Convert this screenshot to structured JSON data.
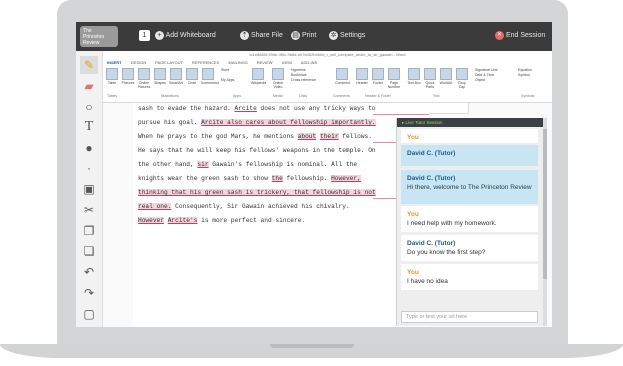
{
  "header": {
    "logo_line1": "The",
    "logo_line2": "Princeton",
    "logo_line3": "Review",
    "page_number": "1",
    "add_whiteboard": "Add Whiteboard",
    "share_file": "Share File",
    "print": "Print",
    "settings": "Settings",
    "end_session": "End Session"
  },
  "word": {
    "title": "tc1e6880f-93de-4f0c-9b6d-b07a452b4b0d_r_will_compare_arcite_to_sir_gawain - Word",
    "tabs": [
      "INSERT",
      "DESIGN",
      "PAGE LAYOUT",
      "REFERENCES",
      "MAILINGS",
      "REVIEW",
      "VIEW",
      "ADD-INS"
    ],
    "ribbon_buttons": [
      "Table",
      "Pictures",
      "Online Pictures",
      "Shapes",
      "SmartArt",
      "Chart",
      "Screenshot",
      "Store",
      "My Apps",
      "Wikipedia",
      "Online Video",
      "Hyperlink",
      "Bookmark",
      "Cross-reference",
      "Comment",
      "Header",
      "Footer",
      "Page Number",
      "Text Box",
      "Quick Parts",
      "WordArt",
      "Drop Cap",
      "Signature Line",
      "Date & Time",
      "Object",
      "Equation",
      "Symbol"
    ],
    "ribbon_groups": [
      "Tables",
      "Illustrations",
      "Apps",
      "Media",
      "Links",
      "Comments",
      "Header & Footer",
      "Text",
      "Symbols"
    ],
    "user_name": "Arna",
    "comment_name": "Anna",
    "comment_text": "bad use of",
    "lines": [
      [
        "sash to evade the hazard. ",
        "Arcite",
        " does not use any tricky ways to"
      ],
      [
        "pursue his goal. ",
        "Arcite also cares about fellowship importantly.",
        ""
      ],
      [
        "When he prays to the god Mars, he mentions ",
        "about",
        " ",
        "their",
        " fellows."
      ],
      [
        "He says that he will keep his fellows' weapons in the temple. On"
      ],
      [
        "the other hand, ",
        "sir",
        " Gawain's fellowship is nominal. All the"
      ],
      [
        "knights wear the green sash to show ",
        "the",
        " fellowship. ",
        "However,"
      ],
      [
        "thinking that his green sash is trickery, that fellowship is not"
      ],
      [
        "real one.",
        " Consequently, Sir Gawain achieved his chivalry."
      ],
      [
        "However",
        " ",
        "Arcite's",
        " is more perfect and sincere."
      ]
    ]
  },
  "chat": {
    "header": "Live Tutor Session",
    "messages": [
      {
        "who": "You",
        "text": "",
        "type": "you"
      },
      {
        "who": "David C. (Tutor)",
        "text": "",
        "type": "tutor"
      },
      {
        "who": "David C. (Tutor)",
        "text": "Hi there, welcome to The Princeton Review",
        "type": "tutor"
      },
      {
        "who": "You",
        "text": "I need help with my homework.",
        "type": "you"
      },
      {
        "who": "David C. (Tutor)",
        "text": "Do you know the first step?",
        "type": "you"
      },
      {
        "who": "You",
        "text": "I have no idea",
        "type": "you"
      }
    ],
    "input_placeholder": "Type or text your url here"
  },
  "tools": [
    "pencil-icon",
    "eraser-icon",
    "circle-icon",
    "text-icon",
    "color-palette-icon",
    "dot-icon",
    "image-icon",
    "scissors-icon",
    "copy-icon",
    "paste-icon",
    "undo-icon",
    "redo-icon",
    "rectangle-icon"
  ]
}
